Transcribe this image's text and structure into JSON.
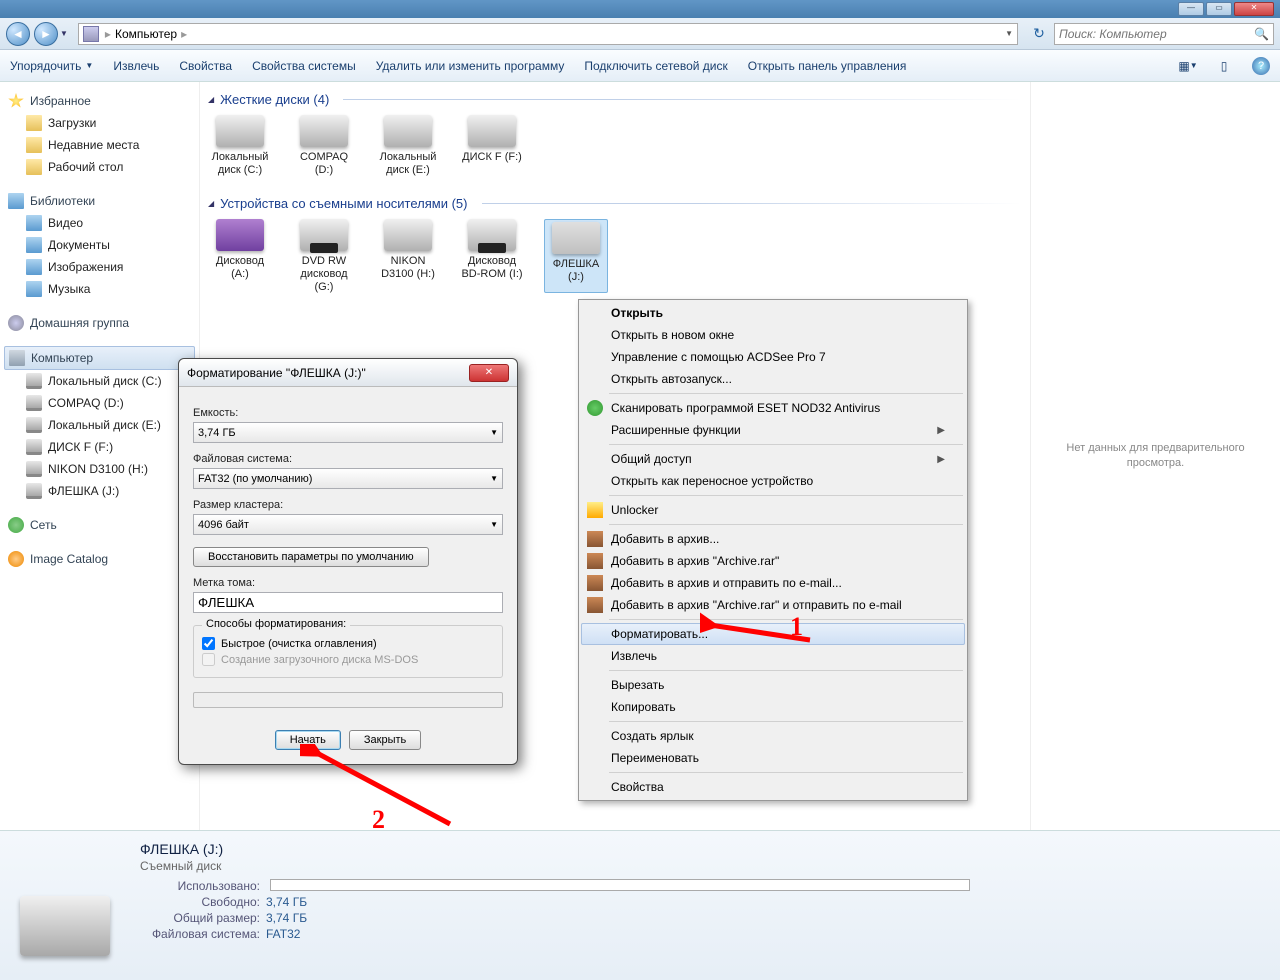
{
  "window": {
    "title": "Компьютер"
  },
  "nav": {
    "location": "Компьютер",
    "search_placeholder": "Поиск: Компьютер"
  },
  "toolbar": {
    "organize": "Упорядочить",
    "eject": "Извлечь",
    "properties": "Свойства",
    "sys_properties": "Свойства системы",
    "uninstall": "Удалить или изменить программу",
    "map_drive": "Подключить сетевой диск",
    "control_panel": "Открыть панель управления"
  },
  "sidebar": {
    "favorites": {
      "label": "Избранное",
      "items": [
        "Загрузки",
        "Недавние места",
        "Рабочий стол"
      ]
    },
    "libraries": {
      "label": "Библиотеки",
      "items": [
        "Видео",
        "Документы",
        "Изображения",
        "Музыка"
      ]
    },
    "homegroup": "Домашняя группа",
    "computer": {
      "label": "Компьютер",
      "drives": [
        "Локальный диск (C:)",
        "COMPAQ (D:)",
        "Локальный диск (E:)",
        "ДИСК F (F:)",
        "NIKON D3100 (H:)",
        "ФЛЕШКА (J:)"
      ]
    },
    "network": "Сеть",
    "image_catalog": "Image Catalog"
  },
  "main": {
    "group1": {
      "title": "Жесткие диски (4)",
      "drives": [
        {
          "name": "Локальный диск (C:)"
        },
        {
          "name": "COMPAQ (D:)"
        },
        {
          "name": "Локальный диск (E:)"
        },
        {
          "name": "ДИСК F (F:)"
        }
      ]
    },
    "group2": {
      "title": "Устройства со съемными носителями (5)",
      "drives": [
        {
          "name": "Дисковод (A:)"
        },
        {
          "name": "DVD RW дисковод (G:)"
        },
        {
          "name": "NIKON D3100 (H:)"
        },
        {
          "name": "Дисковод BD-ROM (I:)"
        },
        {
          "name": "ФЛЕШКА (J:)"
        }
      ]
    }
  },
  "preview": {
    "empty": "Нет данных для предварительного просмотра."
  },
  "context_menu": {
    "open": "Открыть",
    "open_new": "Открыть в новом окне",
    "acdsee": "Управление с помощью ACDSee Pro 7",
    "autoplay": "Открыть автозапуск...",
    "eset": "Сканировать программой ESET NOD32 Antivirus",
    "ext_funcs": "Расширенные функции",
    "share": "Общий доступ",
    "portable": "Открыть как переносное устройство",
    "unlocker": "Unlocker",
    "rar1": "Добавить в архив...",
    "rar2": "Добавить в архив \"Archive.rar\"",
    "rar3": "Добавить в архив и отправить по e-mail...",
    "rar4": "Добавить в архив \"Archive.rar\" и отправить по e-mail",
    "format": "Форматировать...",
    "eject": "Извлечь",
    "cut": "Вырезать",
    "copy": "Копировать",
    "shortcut": "Создать ярлык",
    "rename": "Переименовать",
    "props": "Свойства"
  },
  "dialog": {
    "title": "Форматирование \"ФЛЕШКА (J:)\"",
    "capacity_label": "Емкость:",
    "capacity": "3,74 ГБ",
    "fs_label": "Файловая система:",
    "fs": "FAT32 (по умолчанию)",
    "cluster_label": "Размер кластера:",
    "cluster": "4096 байт",
    "restore": "Восстановить параметры по умолчанию",
    "volume_label": "Метка тома:",
    "volume": "ФЛЕШКА",
    "methods": "Способы форматирования:",
    "quick": "Быстрое (очистка оглавления)",
    "msdos": "Создание загрузочного диска MS-DOS",
    "start": "Начать",
    "close": "Закрыть"
  },
  "details": {
    "title": "ФЛЕШКА (J:)",
    "subtitle": "Съемный диск",
    "used_label": "Использовано:",
    "used": "",
    "free_label": "Свободно:",
    "free": "3,74 ГБ",
    "total_label": "Общий размер:",
    "total": "3,74 ГБ",
    "fs_label": "Файловая система:",
    "fs": "FAT32"
  },
  "anno": {
    "one": "1",
    "two": "2"
  }
}
